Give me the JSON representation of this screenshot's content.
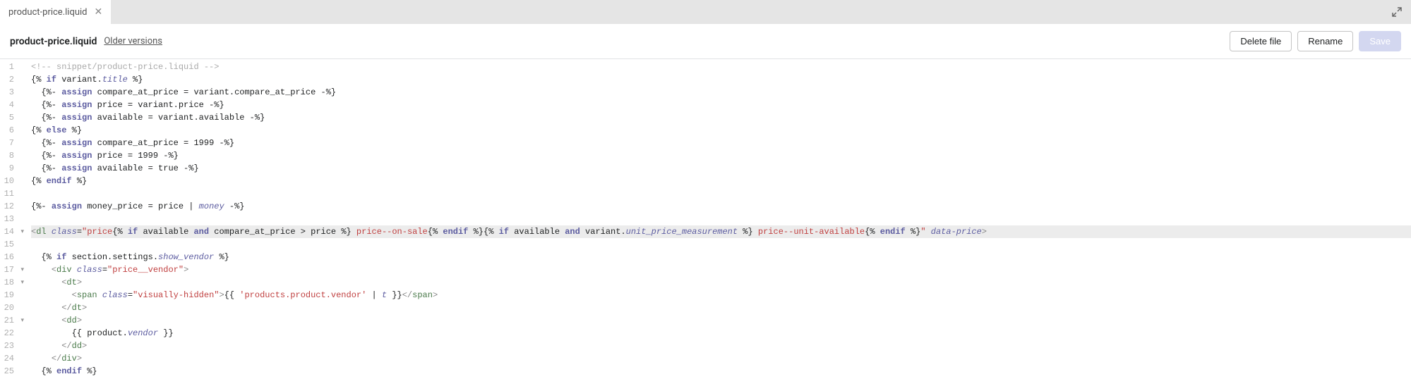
{
  "tab": {
    "label": "product-price.liquid"
  },
  "toolbar": {
    "title": "product-price.liquid",
    "older_versions": "Older versions",
    "delete_label": "Delete file",
    "rename_label": "Rename",
    "save_label": "Save"
  },
  "editor": {
    "lines": [
      {
        "n": 1,
        "hl": false,
        "fold": "",
        "segs": [
          [
            "c-comment",
            "<!-- snippet/product-price.liquid -->"
          ]
        ]
      },
      {
        "n": 2,
        "hl": false,
        "fold": "",
        "segs": [
          [
            "",
            "{% "
          ],
          [
            "c-keyword",
            "if"
          ],
          [
            "",
            " variant."
          ],
          [
            "c-ident",
            "title"
          ],
          [
            "",
            " %}"
          ]
        ]
      },
      {
        "n": 3,
        "hl": false,
        "fold": "",
        "segs": [
          [
            "",
            "  {%- "
          ],
          [
            "c-keyword",
            "assign"
          ],
          [
            "",
            " compare_at_price = variant.compare_at_price -%}"
          ]
        ]
      },
      {
        "n": 4,
        "hl": false,
        "fold": "",
        "segs": [
          [
            "",
            "  {%- "
          ],
          [
            "c-keyword",
            "assign"
          ],
          [
            "",
            " price = variant.price -%}"
          ]
        ]
      },
      {
        "n": 5,
        "hl": false,
        "fold": "",
        "segs": [
          [
            "",
            "  {%- "
          ],
          [
            "c-keyword",
            "assign"
          ],
          [
            "",
            " available = variant.available -%}"
          ]
        ]
      },
      {
        "n": 6,
        "hl": false,
        "fold": "",
        "segs": [
          [
            "",
            "{% "
          ],
          [
            "c-keyword",
            "else"
          ],
          [
            "",
            " %}"
          ]
        ]
      },
      {
        "n": 7,
        "hl": false,
        "fold": "",
        "segs": [
          [
            "",
            "  {%- "
          ],
          [
            "c-keyword",
            "assign"
          ],
          [
            "",
            " compare_at_price = 1999 -%}"
          ]
        ]
      },
      {
        "n": 8,
        "hl": false,
        "fold": "",
        "segs": [
          [
            "",
            "  {%- "
          ],
          [
            "c-keyword",
            "assign"
          ],
          [
            "",
            " price = 1999 -%}"
          ]
        ]
      },
      {
        "n": 9,
        "hl": false,
        "fold": "",
        "segs": [
          [
            "",
            "  {%- "
          ],
          [
            "c-keyword",
            "assign"
          ],
          [
            "",
            " available = true -%}"
          ]
        ]
      },
      {
        "n": 10,
        "hl": false,
        "fold": "",
        "segs": [
          [
            "",
            "{% "
          ],
          [
            "c-keyword",
            "endif"
          ],
          [
            "",
            " %}"
          ]
        ]
      },
      {
        "n": 11,
        "hl": false,
        "fold": "",
        "segs": [
          [
            "",
            ""
          ]
        ]
      },
      {
        "n": 12,
        "hl": false,
        "fold": "",
        "segs": [
          [
            "",
            "{%- "
          ],
          [
            "c-keyword",
            "assign"
          ],
          [
            "",
            " money_price = price | "
          ],
          [
            "c-ident",
            "money"
          ],
          [
            "",
            " -%}"
          ]
        ]
      },
      {
        "n": 13,
        "hl": false,
        "fold": "",
        "segs": [
          [
            "",
            ""
          ]
        ]
      },
      {
        "n": 14,
        "hl": true,
        "fold": "▾",
        "segs": [
          [
            "c-delim",
            "<"
          ],
          [
            "c-tag",
            "dl"
          ],
          [
            "",
            " "
          ],
          [
            "c-attr",
            "class"
          ],
          [
            "",
            "="
          ],
          [
            "c-string",
            "\"price"
          ],
          [
            "",
            "{% "
          ],
          [
            "c-keyword",
            "if"
          ],
          [
            "",
            " available "
          ],
          [
            "c-keyword",
            "and"
          ],
          [
            "",
            " compare_at_price > price %}"
          ],
          [
            "c-string",
            " price--on-sale"
          ],
          [
            "",
            "{% "
          ],
          [
            "c-keyword",
            "endif"
          ],
          [
            "",
            " %}{% "
          ],
          [
            "c-keyword",
            "if"
          ],
          [
            "",
            " available "
          ],
          [
            "c-keyword",
            "and"
          ],
          [
            "",
            " variant."
          ],
          [
            "c-ident",
            "unit_price_measurement"
          ],
          [
            "",
            " %}"
          ],
          [
            "c-string",
            " price--unit-available"
          ],
          [
            "",
            "{% "
          ],
          [
            "c-keyword",
            "endif"
          ],
          [
            "",
            " %}"
          ],
          [
            "c-string",
            "\""
          ],
          [
            "",
            " "
          ],
          [
            "c-attr",
            "data-price"
          ],
          [
            "c-delim",
            ">"
          ]
        ]
      },
      {
        "n": 15,
        "hl": false,
        "fold": "",
        "segs": [
          [
            "",
            ""
          ]
        ]
      },
      {
        "n": 16,
        "hl": false,
        "fold": "",
        "segs": [
          [
            "",
            "  {% "
          ],
          [
            "c-keyword",
            "if"
          ],
          [
            "",
            " section.settings."
          ],
          [
            "c-ident",
            "show_vendor"
          ],
          [
            "",
            " %}"
          ]
        ]
      },
      {
        "n": 17,
        "hl": false,
        "fold": "▾",
        "segs": [
          [
            "",
            "    "
          ],
          [
            "c-delim",
            "<"
          ],
          [
            "c-tag",
            "div"
          ],
          [
            "",
            " "
          ],
          [
            "c-attr",
            "class"
          ],
          [
            "",
            "="
          ],
          [
            "c-string",
            "\"price__vendor\""
          ],
          [
            "c-delim",
            ">"
          ]
        ]
      },
      {
        "n": 18,
        "hl": false,
        "fold": "▾",
        "segs": [
          [
            "",
            "      "
          ],
          [
            "c-delim",
            "<"
          ],
          [
            "c-tag",
            "dt"
          ],
          [
            "c-delim",
            ">"
          ]
        ]
      },
      {
        "n": 19,
        "hl": false,
        "fold": "",
        "segs": [
          [
            "",
            "        "
          ],
          [
            "c-delim",
            "<"
          ],
          [
            "c-tag",
            "span"
          ],
          [
            "",
            " "
          ],
          [
            "c-attr",
            "class"
          ],
          [
            "",
            "="
          ],
          [
            "c-string",
            "\"visually-hidden\""
          ],
          [
            "c-delim",
            ">"
          ],
          [
            "",
            "{{ "
          ],
          [
            "c-string",
            "'products.product.vendor'"
          ],
          [
            "",
            " | "
          ],
          [
            "c-filter",
            "t"
          ],
          [
            "",
            " }}"
          ],
          [
            "c-delim",
            "</"
          ],
          [
            "c-tag",
            "span"
          ],
          [
            "c-delim",
            ">"
          ]
        ]
      },
      {
        "n": 20,
        "hl": false,
        "fold": "",
        "segs": [
          [
            "",
            "      "
          ],
          [
            "c-delim",
            "</"
          ],
          [
            "c-tag",
            "dt"
          ],
          [
            "c-delim",
            ">"
          ]
        ]
      },
      {
        "n": 21,
        "hl": false,
        "fold": "▾",
        "segs": [
          [
            "",
            "      "
          ],
          [
            "c-delim",
            "<"
          ],
          [
            "c-tag",
            "dd"
          ],
          [
            "c-delim",
            ">"
          ]
        ]
      },
      {
        "n": 22,
        "hl": false,
        "fold": "",
        "segs": [
          [
            "",
            "        {{ product."
          ],
          [
            "c-ident",
            "vendor"
          ],
          [
            "",
            " }}"
          ]
        ]
      },
      {
        "n": 23,
        "hl": false,
        "fold": "",
        "segs": [
          [
            "",
            "      "
          ],
          [
            "c-delim",
            "</"
          ],
          [
            "c-tag",
            "dd"
          ],
          [
            "c-delim",
            ">"
          ]
        ]
      },
      {
        "n": 24,
        "hl": false,
        "fold": "",
        "segs": [
          [
            "",
            "    "
          ],
          [
            "c-delim",
            "</"
          ],
          [
            "c-tag",
            "div"
          ],
          [
            "c-delim",
            ">"
          ]
        ]
      },
      {
        "n": 25,
        "hl": false,
        "fold": "",
        "segs": [
          [
            "",
            "  {% "
          ],
          [
            "c-keyword",
            "endif"
          ],
          [
            "",
            " %}"
          ]
        ]
      }
    ]
  }
}
